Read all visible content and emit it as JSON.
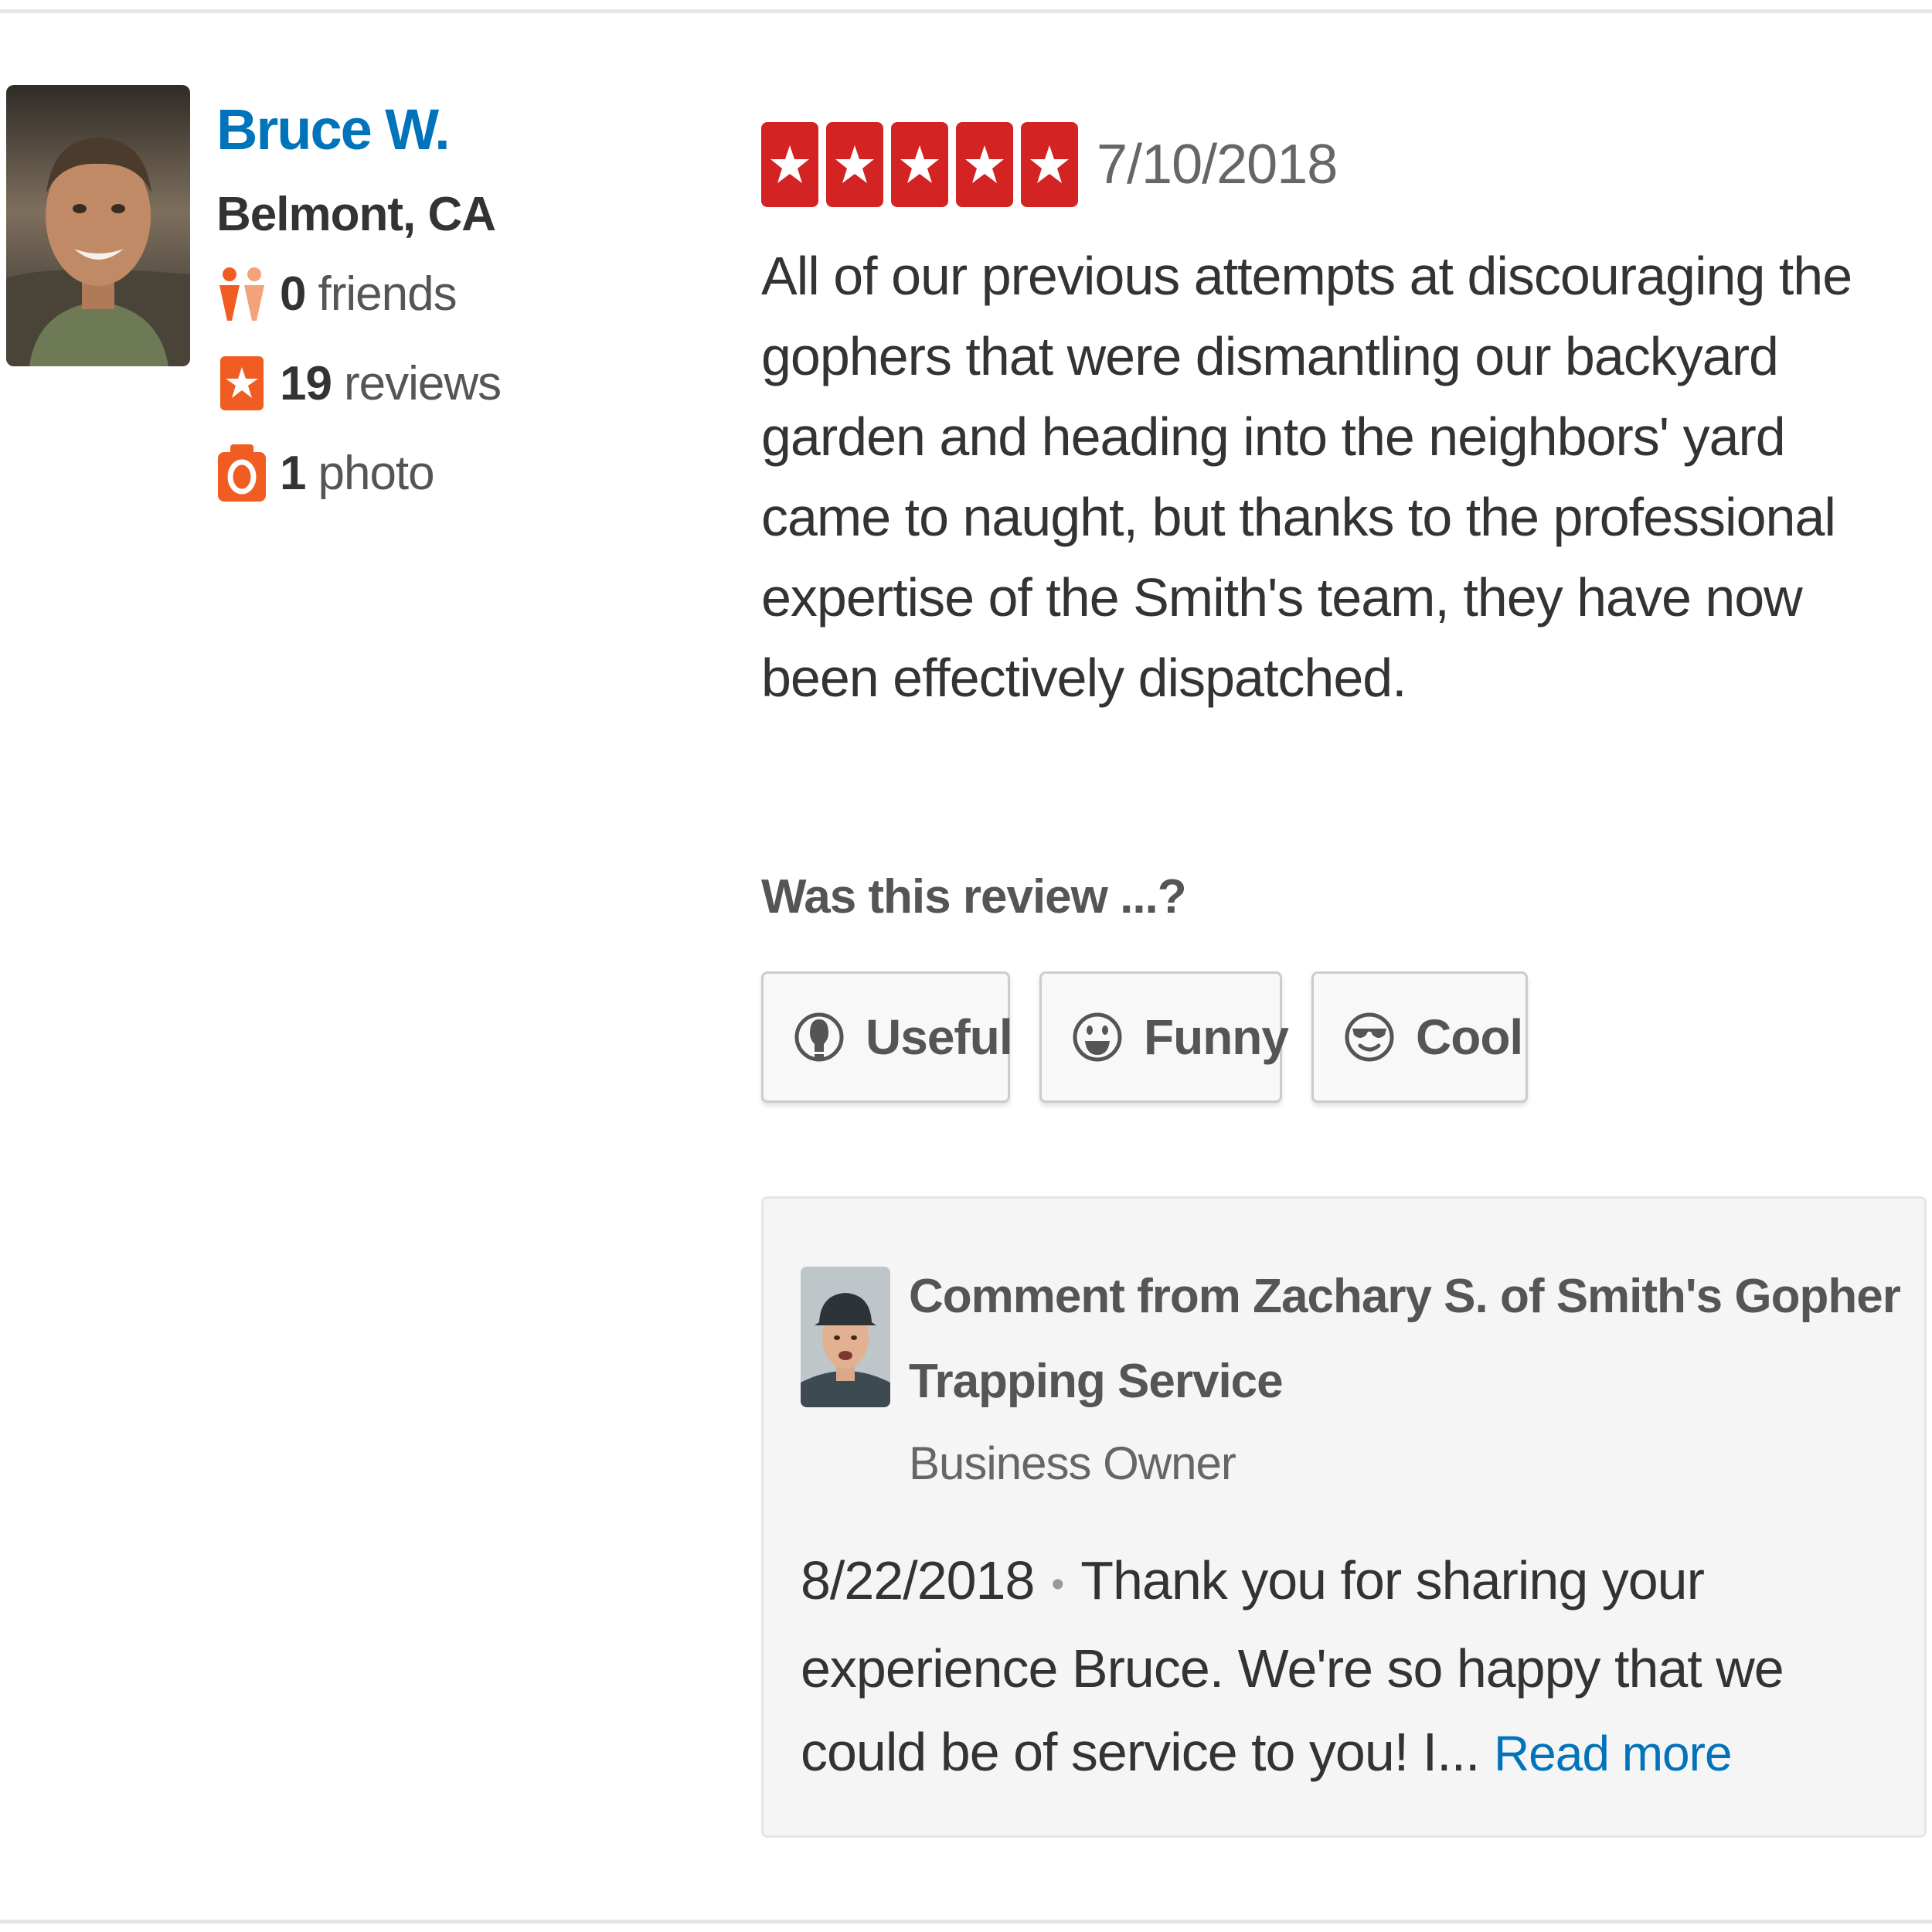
{
  "reviewer": {
    "name": "Bruce W.",
    "location": "Belmont, CA",
    "friends_count": "0",
    "friends_label": "friends",
    "reviews_count": "19",
    "reviews_label": "reviews",
    "photos_count": "1",
    "photos_label": "photo"
  },
  "review": {
    "rating": 5,
    "date": "7/10/2018",
    "text": "All of our previous attempts at discouraging the gophers that were dismantling our backyard garden and heading into the neighbors' yard came to naught, but thanks to the professional expertise of the Smith's team, they have now been effectively dispatched."
  },
  "votes": {
    "question": "Was this review ...?",
    "useful_label": "Useful",
    "funny_label": "Funny",
    "cool_label": "Cool"
  },
  "owner_comment": {
    "title": "Comment from Zachary S. of Smith's Gopher Trapping Service",
    "role": "Business Owner",
    "date": "8/22/2018",
    "separator": "•",
    "text": "Thank you for sharing your experience Bruce. We're so happy that we could be of service to you! I...",
    "read_more": "Read more"
  },
  "colors": {
    "link_blue": "#0073bb",
    "star_red": "#d32323",
    "icon_orange": "#f15c22"
  },
  "icons": {
    "friends": "friends-icon",
    "reviews": "review-star-icon",
    "photos": "camera-icon",
    "useful": "lightbulb-icon",
    "funny": "smiley-icon",
    "cool": "sunglasses-icon"
  }
}
